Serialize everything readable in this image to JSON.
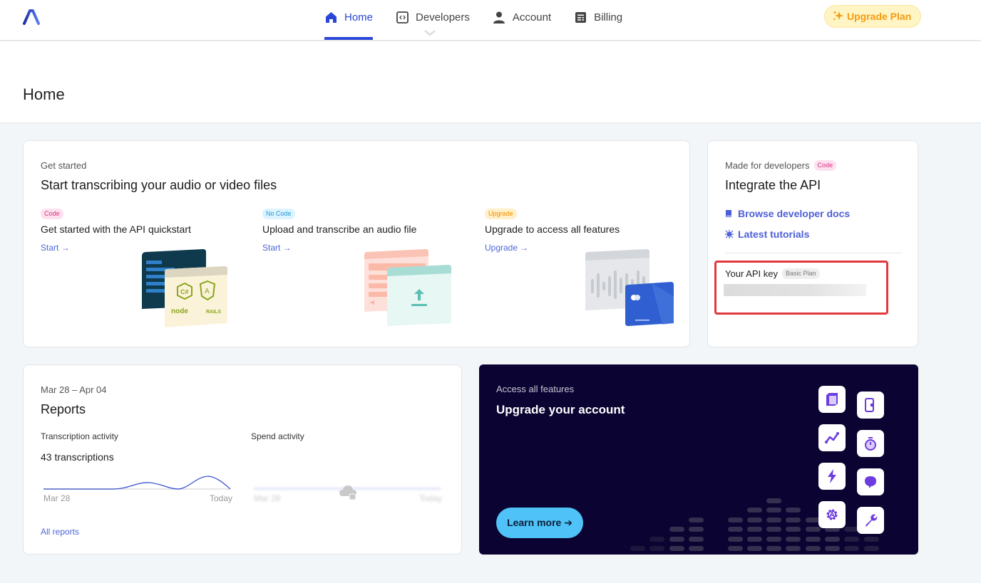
{
  "nav": {
    "logo": "logo-mark",
    "items": [
      {
        "label": "Home",
        "icon": "home-icon",
        "active": true
      },
      {
        "label": "Developers",
        "icon": "code-icon",
        "active": false
      },
      {
        "label": "Account",
        "icon": "user-icon",
        "active": false
      },
      {
        "label": "Billing",
        "icon": "billing-icon",
        "active": false
      }
    ],
    "upgrade_label": "Upgrade Plan",
    "upgrade_icon": "sparkle-icon"
  },
  "page": {
    "title": "Home"
  },
  "get_started": {
    "eyebrow": "Get started",
    "title": "Start transcribing your audio or video files",
    "columns": [
      {
        "badge": "Code",
        "title": "Get started with the API quickstart",
        "link": "Start →"
      },
      {
        "badge": "No Code",
        "title": "Upload and transcribe an audio file",
        "link": "Start →"
      },
      {
        "badge": "Upgrade",
        "title": "Upgrade to access all features",
        "link": "Upgrade →"
      }
    ],
    "illustration_labels": {
      "csharp": "C#",
      "angular": "A",
      "node": "node",
      "rails": "RAILS"
    }
  },
  "developers": {
    "eyebrow": "Made for developers",
    "badge": "Code",
    "title": "Integrate the API",
    "links": [
      {
        "label": "Browse developer docs",
        "icon": "book-icon"
      },
      {
        "label": "Latest tutorials",
        "icon": "bug-icon"
      }
    ],
    "api_key_label": "Your API key",
    "api_key_plan": "Basic Plan"
  },
  "reports": {
    "range": "Mar 28 – Apr 04",
    "title": "Reports",
    "transcription": {
      "label": "Transcription activity",
      "value": "43 transcriptions",
      "x_start": "Mar 28",
      "x_end": "Today"
    },
    "spend": {
      "label": "Spend activity",
      "x_start": "Mar 28",
      "x_end": "Today",
      "locked": true
    },
    "all_link": "All reports"
  },
  "upgrade": {
    "eyebrow": "Access all features",
    "title": "Upgrade your account",
    "button": "Learn more ➔",
    "feature_icons": [
      "cube-icon",
      "phone-audio-icon",
      "analytics-icon",
      "stopwatch-icon",
      "lightning-icon",
      "chat-bubble-icon",
      "settings-gear-icon",
      "wrench-icon"
    ]
  },
  "colors": {
    "accent": "#2a46d6",
    "link": "#4d66d9",
    "upgrade_bg": "#fff4c4",
    "upgrade_text": "#f39c12",
    "dark_bg": "#0b0331",
    "learn_btn": "#4fc3f7",
    "highlight": "#e0393c",
    "feature_purple": "#6c3ce0"
  }
}
